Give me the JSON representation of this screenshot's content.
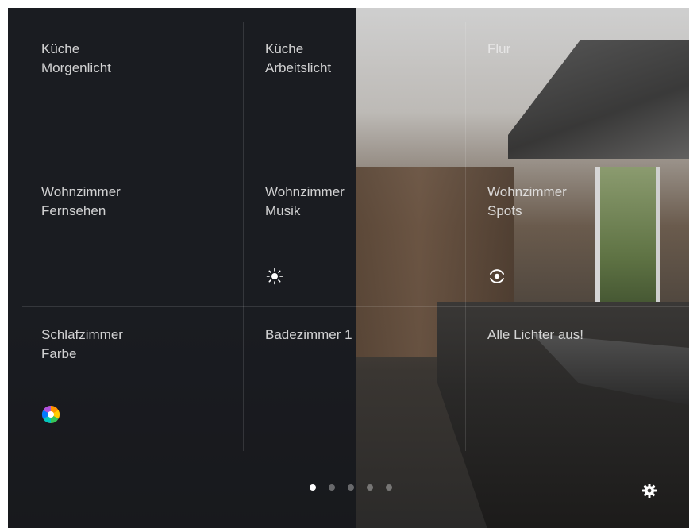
{
  "tiles": [
    {
      "name": "Küche\nMorgenlicht"
    },
    {
      "name": "Küche\nArbeitslicht"
    },
    {
      "name": "Flur"
    },
    {
      "name": "Wohnzimmer\nFernsehen"
    },
    {
      "name": "Wohnzimmer\nMusik"
    },
    {
      "name": "Wohnzimmer\nSpots"
    },
    {
      "name": "Schlafzimmer\nFarbe"
    },
    {
      "name": "Badezimmer 1"
    },
    {
      "name": "Alle Lichter aus!"
    }
  ],
  "icons": {
    "musik": "sun-icon",
    "spots": "circle-dot-icon",
    "farbe": "color-wheel-icon",
    "settings": "gear-icon"
  },
  "pager": {
    "total": 5,
    "active": 1
  },
  "colors": {
    "panel": "#1f2024",
    "text": "#ebebeb",
    "accent": "#ffffff"
  }
}
